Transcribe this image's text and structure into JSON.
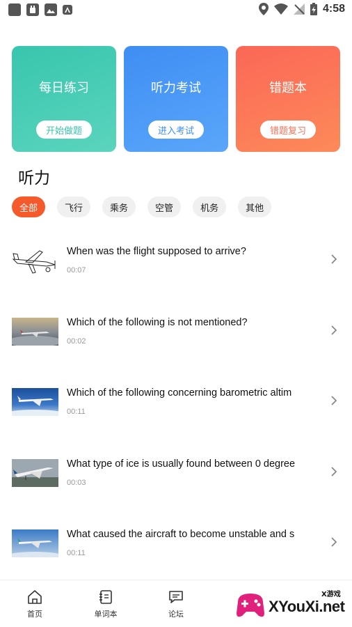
{
  "status_bar": {
    "time": "4:58",
    "left_icons": [
      "app-icon",
      "notification-hand-icon",
      "image-icon",
      "text-a-icon"
    ],
    "right_icons": [
      "location-icon",
      "wifi-icon",
      "signal-off-icon",
      "battery-charging-icon"
    ]
  },
  "cards": [
    {
      "title": "每日练习",
      "button": "开始做题",
      "color": "#38c6ae"
    },
    {
      "title": "听力考试",
      "button": "进入考试",
      "color": "#3e8ef3"
    },
    {
      "title": "错题本",
      "button": "错题复习",
      "color": "#fb6757"
    }
  ],
  "section_title": "听力",
  "filters": {
    "active": "全部",
    "items": [
      "全部",
      "飞行",
      "乘务",
      "空管",
      "机务",
      "其他"
    ]
  },
  "list": [
    {
      "title": "When was the flight supposed to arrive?",
      "duration": "00:07",
      "thumb": "propeller-plane-sketch"
    },
    {
      "title": "Which of the following is not mentioned?",
      "duration": "00:02",
      "thumb": "airliner-above-clouds"
    },
    {
      "title": "Which of the following concerning barometric altim",
      "duration": "00:11",
      "thumb": "airliner-blue-sky"
    },
    {
      "title": "What type of ice is usually found between 0 degree",
      "duration": "00:03",
      "thumb": "airliner-takeoff"
    },
    {
      "title": " What caused the aircraft to become unstable and s",
      "duration": "00:11",
      "thumb": "airliner-sky"
    }
  ],
  "bottom_nav": [
    {
      "label": "首页",
      "icon": "home-icon"
    },
    {
      "label": "单词本",
      "icon": "notebook-icon"
    },
    {
      "label": "论坛",
      "icon": "chat-icon"
    }
  ],
  "watermark": {
    "text": "XYouXi.net",
    "small": "X游戏"
  }
}
